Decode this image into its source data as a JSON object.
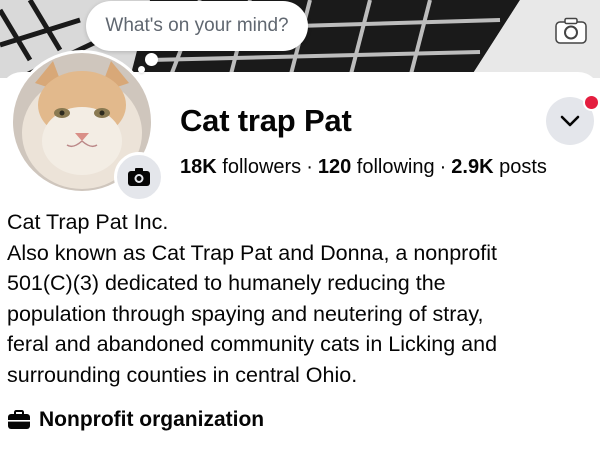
{
  "composer": {
    "placeholder": "What's on your mind?"
  },
  "profile": {
    "name": "Cat trap Pat",
    "stats": {
      "followers_count": "18K",
      "followers_label": "followers",
      "following_count": "120",
      "following_label": "following",
      "posts_count": "2.9K",
      "posts_label": "posts",
      "separator": "·"
    }
  },
  "bio": {
    "lines": [
      "Cat Trap Pat Inc.",
      "Also known as Cat Trap Pat and Donna, a nonprofit",
      "501(C)(3) dedicated to humanely reducing the",
      "population through spaying and neutering of stray,",
      "feral and abandoned community cats in Licking and",
      "surrounding counties in central Ohio."
    ]
  },
  "category": {
    "label": "Nonprofit organization",
    "icon": "briefcase-icon"
  },
  "icons": {
    "cover_camera": "camera-icon",
    "avatar_camera": "camera-icon",
    "dropdown": "chevron-down-icon"
  },
  "colors": {
    "notification": "#e41e3f",
    "button_bg": "#e4e6eb",
    "text": "#050505",
    "muted": "#606770"
  }
}
